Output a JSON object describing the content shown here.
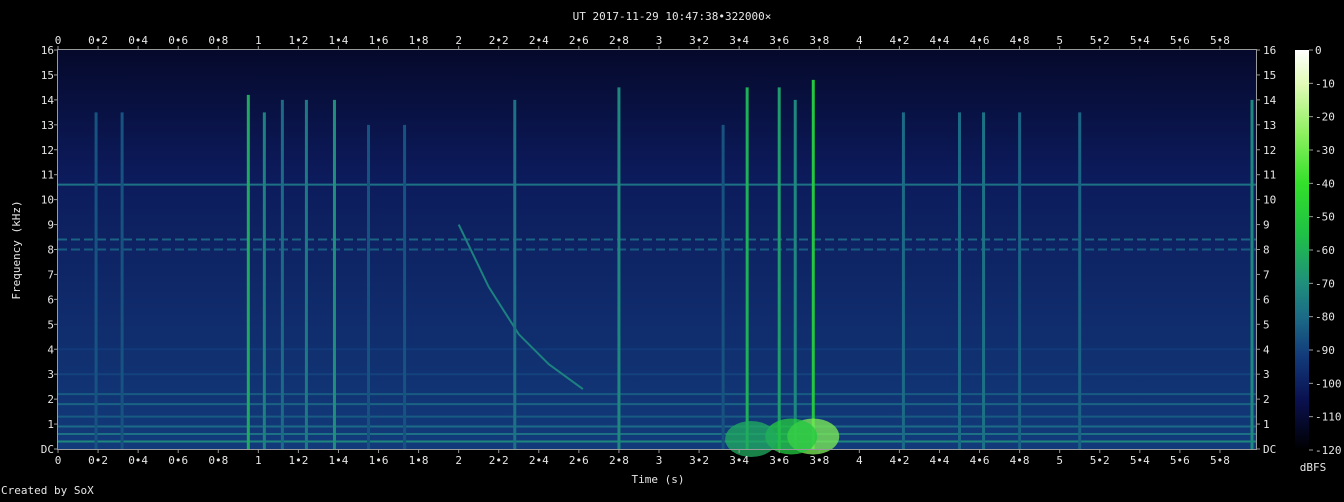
{
  "chart_data": {
    "type": "heatmap",
    "title": "UT 2017-11-29 10:47:38•322000×",
    "xlabel": "Time (s)",
    "ylabel": "Frequency (kHz)",
    "xlim": [
      0,
      5.98
    ],
    "ylim": [
      0,
      16
    ],
    "x_ticks": [
      {
        "v": 0,
        "label": "0"
      },
      {
        "v": 0.2,
        "label": "0•2"
      },
      {
        "v": 0.4,
        "label": "0•4"
      },
      {
        "v": 0.6,
        "label": "0•6"
      },
      {
        "v": 0.8,
        "label": "0•8"
      },
      {
        "v": 1,
        "label": "1"
      },
      {
        "v": 1.2,
        "label": "1•2"
      },
      {
        "v": 1.4,
        "label": "1•4"
      },
      {
        "v": 1.6,
        "label": "1•6"
      },
      {
        "v": 1.8,
        "label": "1•8"
      },
      {
        "v": 2,
        "label": "2"
      },
      {
        "v": 2.2,
        "label": "2•2"
      },
      {
        "v": 2.4,
        "label": "2•4"
      },
      {
        "v": 2.6,
        "label": "2•6"
      },
      {
        "v": 2.8,
        "label": "2•8"
      },
      {
        "v": 3,
        "label": "3"
      },
      {
        "v": 3.2,
        "label": "3•2"
      },
      {
        "v": 3.4,
        "label": "3•4"
      },
      {
        "v": 3.6,
        "label": "3•6"
      },
      {
        "v": 3.8,
        "label": "3•8"
      },
      {
        "v": 4,
        "label": "4"
      },
      {
        "v": 4.2,
        "label": "4•2"
      },
      {
        "v": 4.4,
        "label": "4•4"
      },
      {
        "v": 4.6,
        "label": "4•6"
      },
      {
        "v": 4.8,
        "label": "4•8"
      },
      {
        "v": 5,
        "label": "5"
      },
      {
        "v": 5.2,
        "label": "5•2"
      },
      {
        "v": 5.4,
        "label": "5•4"
      },
      {
        "v": 5.6,
        "label": "5•6"
      },
      {
        "v": 5.8,
        "label": "5•8"
      }
    ],
    "y_ticks": [
      {
        "v": 0,
        "label": "DC"
      },
      {
        "v": 1,
        "label": "1"
      },
      {
        "v": 2,
        "label": "2"
      },
      {
        "v": 3,
        "label": "3"
      },
      {
        "v": 4,
        "label": "4"
      },
      {
        "v": 5,
        "label": "5"
      },
      {
        "v": 6,
        "label": "6"
      },
      {
        "v": 7,
        "label": "7"
      },
      {
        "v": 8,
        "label": "8"
      },
      {
        "v": 9,
        "label": "9"
      },
      {
        "v": 10,
        "label": "10"
      },
      {
        "v": 11,
        "label": "11"
      },
      {
        "v": 12,
        "label": "12"
      },
      {
        "v": 13,
        "label": "13"
      },
      {
        "v": 14,
        "label": "14"
      },
      {
        "v": 15,
        "label": "15"
      },
      {
        "v": 16,
        "label": "16"
      }
    ],
    "colorbar": {
      "label": "dBFS",
      "range": [
        -120,
        0
      ],
      "ticks": [
        {
          "v": 0,
          "label": "0"
        },
        {
          "v": -10,
          "label": "-10"
        },
        {
          "v": -20,
          "label": "-20"
        },
        {
          "v": -30,
          "label": "-30"
        },
        {
          "v": -40,
          "label": "-40"
        },
        {
          "v": -50,
          "label": "-50"
        },
        {
          "v": -60,
          "label": "-60"
        },
        {
          "v": -70,
          "label": "-70"
        },
        {
          "v": -80,
          "label": "-80"
        },
        {
          "v": -90,
          "label": "-90"
        },
        {
          "v": -100,
          "label": "-100"
        },
        {
          "v": -110,
          "label": "-110"
        },
        {
          "v": -120,
          "label": "-120"
        }
      ],
      "stops": [
        {
          "db": -120,
          "color": "#000000"
        },
        {
          "db": -105,
          "color": "#0a1150"
        },
        {
          "db": -92,
          "color": "#123a7a"
        },
        {
          "db": -80,
          "color": "#1b6b86"
        },
        {
          "db": -70,
          "color": "#1f8f7c"
        },
        {
          "db": -55,
          "color": "#1fc245"
        },
        {
          "db": -40,
          "color": "#33e02a"
        },
        {
          "db": -25,
          "color": "#8ef060"
        },
        {
          "db": -10,
          "color": "#e2fbb8"
        },
        {
          "db": 0,
          "color": "#ffffff"
        }
      ]
    },
    "background_db": -96,
    "hum_bands": [
      {
        "f": 0.3,
        "db": -72
      },
      {
        "f": 0.6,
        "db": -78
      },
      {
        "f": 0.9,
        "db": -80
      },
      {
        "f": 1.3,
        "db": -84
      },
      {
        "f": 1.8,
        "db": -82
      },
      {
        "f": 2.2,
        "db": -84
      },
      {
        "f": 3.0,
        "db": -90
      },
      {
        "f": 4.0,
        "db": -92
      },
      {
        "f": 10.6,
        "db": -78
      }
    ],
    "dashed_tones": [
      {
        "f": 8.4,
        "db": -82
      },
      {
        "f": 8.0,
        "db": -84
      }
    ],
    "clicks": [
      {
        "t": 0.19,
        "f_top": 13.5,
        "db": -86
      },
      {
        "t": 0.32,
        "f_top": 13.5,
        "db": -86
      },
      {
        "t": 0.95,
        "f_top": 14.2,
        "db": -62
      },
      {
        "t": 1.03,
        "f_top": 13.5,
        "db": -74
      },
      {
        "t": 1.12,
        "f_top": 14.0,
        "db": -80
      },
      {
        "t": 1.24,
        "f_top": 14.0,
        "db": -76
      },
      {
        "t": 1.38,
        "f_top": 14.0,
        "db": -70
      },
      {
        "t": 1.55,
        "f_top": 13.0,
        "db": -86
      },
      {
        "t": 1.73,
        "f_top": 13.0,
        "db": -86
      },
      {
        "t": 2.28,
        "f_top": 14.0,
        "db": -78
      },
      {
        "t": 2.8,
        "f_top": 14.5,
        "db": -72
      },
      {
        "t": 3.32,
        "f_top": 13.0,
        "db": -86
      },
      {
        "t": 3.44,
        "f_top": 14.5,
        "db": -60
      },
      {
        "t": 3.6,
        "f_top": 14.5,
        "db": -66
      },
      {
        "t": 3.68,
        "f_top": 14.0,
        "db": -72
      },
      {
        "t": 3.77,
        "f_top": 14.8,
        "db": -52
      },
      {
        "t": 4.22,
        "f_top": 13.5,
        "db": -80
      },
      {
        "t": 4.5,
        "f_top": 13.5,
        "db": -80
      },
      {
        "t": 4.62,
        "f_top": 13.5,
        "db": -78
      },
      {
        "t": 4.8,
        "f_top": 13.5,
        "db": -82
      },
      {
        "t": 5.1,
        "f_top": 13.5,
        "db": -82
      },
      {
        "t": 5.96,
        "f_top": 14.0,
        "db": -72
      }
    ],
    "sweeps": [
      {
        "points": [
          [
            2.0,
            9.0
          ],
          [
            2.15,
            6.5
          ],
          [
            2.3,
            4.6
          ],
          [
            2.45,
            3.4
          ],
          [
            2.62,
            2.4
          ]
        ],
        "db": -74
      }
    ],
    "blobs": [
      {
        "t": 3.77,
        "f": 0.5,
        "db": -28
      },
      {
        "t": 3.66,
        "f": 0.5,
        "db": -52
      },
      {
        "t": 3.46,
        "f": 0.4,
        "db": -62
      }
    ]
  },
  "footer": {
    "credit": "Created by SoX"
  }
}
